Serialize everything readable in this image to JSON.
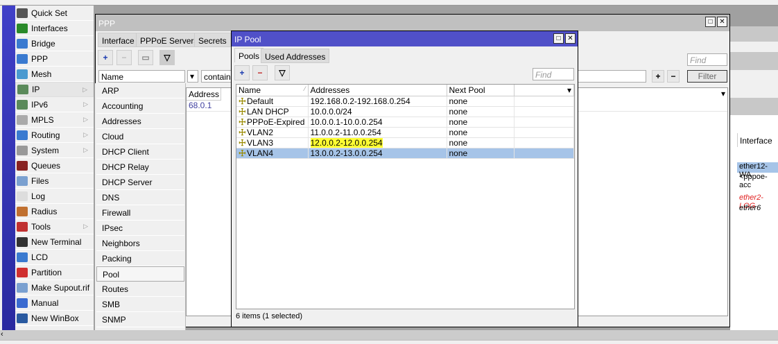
{
  "sidebar": {
    "items": [
      {
        "label": "Quick Set",
        "icon": "quick-set-icon",
        "color": "#555"
      },
      {
        "label": "Interfaces",
        "icon": "interfaces-icon",
        "color": "#2a8a2a"
      },
      {
        "label": "Bridge",
        "icon": "bridge-icon",
        "color": "#3a7ad0"
      },
      {
        "label": "PPP",
        "icon": "ppp-icon",
        "color": "#3a7ad0"
      },
      {
        "label": "Mesh",
        "icon": "mesh-icon",
        "color": "#4a9ad0"
      },
      {
        "label": "IP",
        "icon": "ip-icon",
        "color": "#5a8a5a",
        "submenu": true
      },
      {
        "label": "IPv6",
        "icon": "ipv6-icon",
        "color": "#5a8a5a",
        "submenu": true
      },
      {
        "label": "MPLS",
        "icon": "mpls-icon",
        "color": "#aaa",
        "submenu": true
      },
      {
        "label": "Routing",
        "icon": "routing-icon",
        "color": "#3a7ad0",
        "submenu": true
      },
      {
        "label": "System",
        "icon": "system-icon",
        "color": "#999",
        "submenu": true
      },
      {
        "label": "Queues",
        "icon": "queues-icon",
        "color": "#822"
      },
      {
        "label": "Files",
        "icon": "files-icon",
        "color": "#7aa0d0"
      },
      {
        "label": "Log",
        "icon": "log-icon",
        "color": "#ddd"
      },
      {
        "label": "Radius",
        "icon": "radius-icon",
        "color": "#c07030"
      },
      {
        "label": "Tools",
        "icon": "tools-icon",
        "color": "#c03030",
        "submenu": true
      },
      {
        "label": "New Terminal",
        "icon": "terminal-icon",
        "color": "#333"
      },
      {
        "label": "LCD",
        "icon": "lcd-icon",
        "color": "#3a7ad0"
      },
      {
        "label": "Partition",
        "icon": "partition-icon",
        "color": "#d03030"
      },
      {
        "label": "Make Supout.rif",
        "icon": "file-icon",
        "color": "#7aa0d0"
      },
      {
        "label": "Manual",
        "icon": "help-icon",
        "color": "#3a6ad0"
      },
      {
        "label": "New WinBox",
        "icon": "winbox-icon",
        "color": "#2a5aa0"
      }
    ]
  },
  "ip_menu": {
    "items": [
      "ARP",
      "Accounting",
      "Addresses",
      "Cloud",
      "DHCP Client",
      "DHCP Relay",
      "DHCP Server",
      "DNS",
      "Firewall",
      "IPsec",
      "Neighbors",
      "Packing",
      "Pool",
      "Routes",
      "SMB",
      "SNMP"
    ],
    "selected": "Pool"
  },
  "ppp": {
    "title": "PPP",
    "tabs": [
      "Interface",
      "PPPoE Servers",
      "Secrets"
    ],
    "filter_field": "Name",
    "filter_op": "contains",
    "find_placeholder": "Find",
    "filter_button": "Filter",
    "col_address": "Address",
    "row_value": "68.0.1"
  },
  "bg": {
    "col_interface": "Interface",
    "rows": [
      {
        "text": "ether12-WA",
        "style": "sel"
      },
      {
        "text": "<pppoe-acc",
        "style": ""
      },
      {
        "text": "ether2-LOG",
        "style": "red"
      },
      {
        "text": "ether6",
        "style": "italic"
      }
    ]
  },
  "pool": {
    "title": "IP Pool",
    "tabs": [
      "Pools",
      "Used Addresses"
    ],
    "find_placeholder": "Find",
    "columns": [
      "Name",
      "Addresses",
      "Next Pool"
    ],
    "rows": [
      {
        "name": "Default",
        "addresses": "192.168.0.2-192.168.0.254",
        "next": "none"
      },
      {
        "name": "LAN DHCP",
        "addresses": "10.0.0.0/24",
        "next": "none"
      },
      {
        "name": "PPPoE-Expired",
        "addresses": "10.0.0.1-10.0.0.254",
        "next": "none"
      },
      {
        "name": "VLAN2",
        "addresses": "11.0.0.2-11.0.0.254",
        "next": "none"
      },
      {
        "name": "VLAN3",
        "addresses": "12.0.0.2-12.0.0.254",
        "next": "none",
        "highlight": true
      },
      {
        "name": "VLAN4",
        "addresses": "13.0.0.2-13.0.0.254",
        "next": "none",
        "selected": true
      }
    ],
    "status": "6 items (1 selected)"
  },
  "colors": {
    "pool_title": "#5050c8",
    "selection": "#a6c4e8",
    "highlight": "#ffff33",
    "sidebar_bar": "#3a3ac0"
  }
}
